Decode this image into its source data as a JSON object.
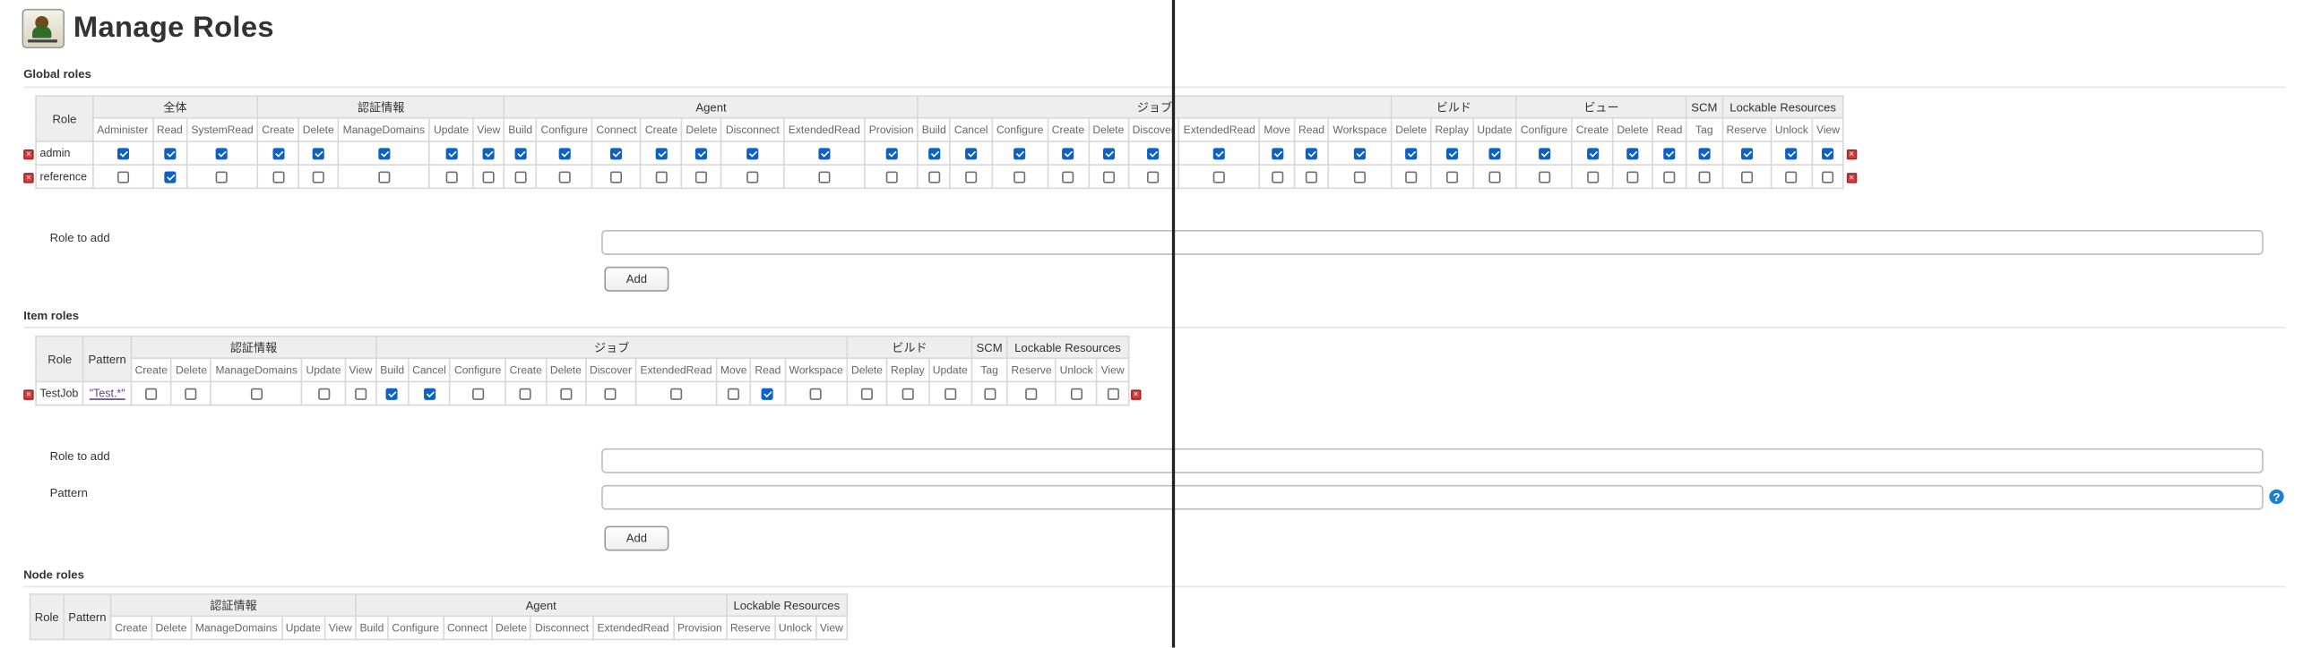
{
  "page": {
    "title": "Manage Roles"
  },
  "global": {
    "heading": "Global roles",
    "role_header": "Role",
    "groups": [
      {
        "label": "全体",
        "perms": [
          "Administer",
          "Read",
          "SystemRead"
        ]
      },
      {
        "label": "認証情報",
        "perms": [
          "Create",
          "Delete",
          "ManageDomains",
          "Update",
          "View"
        ]
      },
      {
        "label": "Agent",
        "perms": [
          "Build",
          "Configure",
          "Connect",
          "Create",
          "Delete",
          "Disconnect",
          "ExtendedRead",
          "Provision"
        ]
      },
      {
        "label": "ジョブ",
        "perms": [
          "Build",
          "Cancel",
          "Configure",
          "Create",
          "Delete",
          "Discover",
          "ExtendedRead",
          "Move",
          "Read",
          "Workspace"
        ]
      },
      {
        "label": "ビルド",
        "perms": [
          "Delete",
          "Replay",
          "Update"
        ]
      },
      {
        "label": "ビュー",
        "perms": [
          "Configure",
          "Create",
          "Delete",
          "Read"
        ]
      },
      {
        "label": "SCM",
        "perms": [
          "Tag"
        ]
      },
      {
        "label": "Lockable Resources",
        "perms": [
          "Reserve",
          "Unlock",
          "View"
        ]
      }
    ],
    "rows": [
      {
        "name": "admin",
        "checks": [
          1,
          1,
          1,
          1,
          1,
          1,
          1,
          1,
          1,
          1,
          1,
          1,
          1,
          1,
          1,
          1,
          1,
          1,
          1,
          1,
          1,
          1,
          1,
          1,
          1,
          1,
          1,
          1,
          1,
          1,
          1,
          1,
          1,
          1,
          1,
          1,
          1
        ]
      },
      {
        "name": "reference",
        "checks": [
          0,
          1,
          0,
          0,
          0,
          0,
          0,
          0,
          0,
          0,
          0,
          0,
          0,
          0,
          0,
          0,
          0,
          0,
          0,
          0,
          0,
          0,
          0,
          0,
          0,
          0,
          0,
          0,
          0,
          0,
          0,
          0,
          0,
          0,
          0,
          0,
          0
        ]
      }
    ],
    "add_form": {
      "role_label": "Role to add",
      "role_value": "",
      "add_button": "Add"
    }
  },
  "item": {
    "heading": "Item roles",
    "role_header": "Role",
    "pattern_header": "Pattern",
    "groups": [
      {
        "label": "認証情報",
        "perms": [
          "Create",
          "Delete",
          "ManageDomains",
          "Update",
          "View"
        ]
      },
      {
        "label": "ジョブ",
        "perms": [
          "Build",
          "Cancel",
          "Configure",
          "Create",
          "Delete",
          "Discover",
          "ExtendedRead",
          "Move",
          "Read",
          "Workspace"
        ]
      },
      {
        "label": "ビルド",
        "perms": [
          "Delete",
          "Replay",
          "Update"
        ]
      },
      {
        "label": "SCM",
        "perms": [
          "Tag"
        ]
      },
      {
        "label": "Lockable Resources",
        "perms": [
          "Reserve",
          "Unlock",
          "View"
        ]
      }
    ],
    "rows": [
      {
        "name": "TestJob",
        "pattern": "\"Test.*\"",
        "checks": [
          0,
          0,
          0,
          0,
          0,
          1,
          1,
          0,
          0,
          0,
          0,
          0,
          0,
          1,
          0,
          0,
          0,
          0,
          0,
          0,
          0,
          0
        ]
      }
    ],
    "add_form": {
      "role_label": "Role to add",
      "role_value": "",
      "pattern_label": "Pattern",
      "pattern_value": "",
      "add_button": "Add",
      "help": "?"
    }
  },
  "node": {
    "heading": "Node roles",
    "role_header": "Role",
    "pattern_header": "Pattern",
    "groups": [
      {
        "label": "認証情報",
        "perms": [
          "Create",
          "Delete",
          "ManageDomains",
          "Update",
          "View"
        ]
      },
      {
        "label": "Agent",
        "perms": [
          "Build",
          "Configure",
          "Connect",
          "Delete",
          "Disconnect",
          "ExtendedRead",
          "Provision"
        ]
      },
      {
        "label": "Lockable Resources",
        "perms": [
          "Reserve",
          "Unlock",
          "View"
        ]
      }
    ]
  },
  "colors": {
    "checkbox_on": "#0b62c6",
    "delete_icon": "#d83a3a",
    "header_bg": "#eeeeee",
    "help_icon": "#1e7fd0"
  },
  "icons": {
    "logo": "jenkins-logo-icon",
    "delete": "delete-icon",
    "help": "help-icon"
  }
}
